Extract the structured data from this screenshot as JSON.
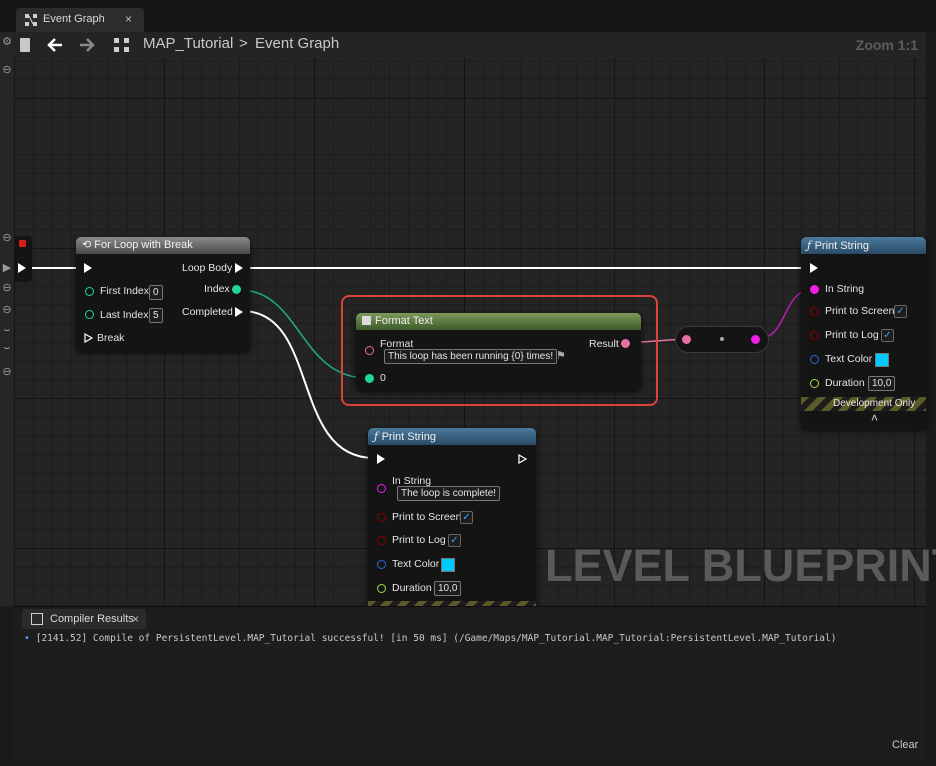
{
  "tab": {
    "label": "Event Graph",
    "close": "×"
  },
  "breadcrumb": {
    "map": "MAP_Tutorial",
    "separator": ">",
    "graph": "Event Graph",
    "zoom": "Zoom 1:1"
  },
  "nodes": {
    "for_loop": {
      "title": "For Loop with Break",
      "loop_body": "Loop Body",
      "first_index_label": "First Index",
      "first_index_value": "0",
      "index": "Index",
      "last_index_label": "Last Index",
      "last_index_value": "5",
      "completed": "Completed",
      "break": "Break"
    },
    "format_text": {
      "title": "Format Text",
      "format_label": "Format",
      "format_value": "This loop has been running {0} times!",
      "result": "Result",
      "arg0": "0"
    },
    "print_string_right": {
      "title": "Print String",
      "in_string": "In String",
      "print_to_screen": "Print to Screen",
      "print_to_screen_checked": "✓",
      "print_to_log": "Print to Log",
      "print_to_log_checked": "✓",
      "text_color": "Text Color",
      "duration": "Duration",
      "duration_value": "10,0",
      "dev_only": "Development Only",
      "expand_glyph": "˄"
    },
    "print_string_bottom": {
      "title": "Print String",
      "in_string": "In String",
      "in_string_value": "The loop is complete!",
      "print_to_screen": "Print to Screen",
      "print_to_screen_checked": "✓",
      "print_to_log": "Print to Log",
      "print_to_log_checked": "✓",
      "text_color": "Text Color",
      "duration": "Duration",
      "duration_value": "10,0"
    }
  },
  "watermark": "LEVEL BLUEPRINT",
  "compiler": {
    "tab_label": "Compiler Results",
    "tab_close": "×",
    "log_bullet": "•",
    "log_message": "[2141.52] Compile of PersistentLevel.MAP_Tutorial successful! [in 50 ms] (/Game/Maps/MAP_Tutorial.MAP_Tutorial:PersistentLevel.MAP_Tutorial)",
    "clear": "Clear"
  },
  "colors": {
    "exec": "#ffffff",
    "int_pin": "#1fd8a0",
    "text_pin": "#e86fa6",
    "string_pin": "#f01ee6",
    "bool_pin": "#8e0000",
    "struct_pin": "#2a6bd6",
    "float_pin": "#9ee04a",
    "highlight": "#d9443a"
  }
}
